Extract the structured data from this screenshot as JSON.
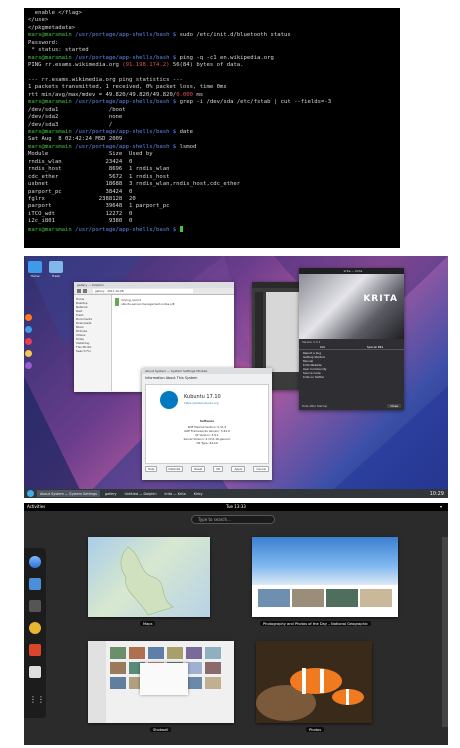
{
  "terminal": {
    "lines": [
      {
        "segments": [
          {
            "t": "  enable </flag>",
            "c": "plain"
          }
        ]
      },
      {
        "segments": [
          {
            "t": "</use>",
            "c": "plain"
          }
        ]
      },
      {
        "segments": [
          {
            "t": "</pkgmetadata>",
            "c": "plain"
          }
        ]
      },
      {
        "segments": [
          {
            "t": "mars@marsmain",
            "c": "user"
          },
          {
            "t": " /usr/portage/app-shells/bash $ ",
            "c": "path"
          },
          {
            "t": "sudo /etc/init.d/bluetooth status",
            "c": "plain"
          }
        ]
      },
      {
        "segments": [
          {
            "t": "Password:",
            "c": "plain"
          }
        ]
      },
      {
        "segments": [
          {
            "t": " * status: started",
            "c": "plain"
          }
        ]
      },
      {
        "segments": [
          {
            "t": "mars@marsmain",
            "c": "user"
          },
          {
            "t": " /usr/portage/app-shells/bash $ ",
            "c": "path"
          },
          {
            "t": "ping -q -c1 en.wikipedia.org",
            "c": "plain"
          }
        ]
      },
      {
        "segments": [
          {
            "t": "PING rr.esams.wikimedia.org ",
            "c": "plain"
          },
          {
            "t": "(91.198.174.2)",
            "c": "red"
          },
          {
            "t": " 56(84) bytes of data.",
            "c": "plain"
          }
        ]
      },
      {
        "segments": [
          {
            "t": "",
            "c": "plain"
          }
        ]
      },
      {
        "segments": [
          {
            "t": "--- rr.esams.wikimedia.org ping statistics ---",
            "c": "plain"
          }
        ]
      },
      {
        "segments": [
          {
            "t": "1 packets transmitted, 1 received, 0% packet loss, time 0ms",
            "c": "plain"
          }
        ]
      },
      {
        "segments": [
          {
            "t": "rtt min/avg/max/mdev = 49.820/49.820/49.820/",
            "c": "plain"
          },
          {
            "t": "0.000",
            "c": "red"
          },
          {
            "t": " ms",
            "c": "plain"
          }
        ]
      },
      {
        "segments": [
          {
            "t": "mars@marsmain",
            "c": "user"
          },
          {
            "t": " /usr/portage/app-shells/bash $ ",
            "c": "path"
          },
          {
            "t": "grep -i /dev/sda /etc/fstab | cut --fields=-3",
            "c": "plain"
          }
        ]
      },
      {
        "segments": [
          {
            "t": "/dev/sda1               /boot",
            "c": "plain"
          }
        ]
      },
      {
        "segments": [
          {
            "t": "/dev/sda2               none",
            "c": "plain"
          }
        ]
      },
      {
        "segments": [
          {
            "t": "/dev/sda3               /",
            "c": "plain"
          }
        ]
      },
      {
        "segments": [
          {
            "t": "mars@marsmain",
            "c": "user"
          },
          {
            "t": " /usr/portage/app-shells/bash $ ",
            "c": "path"
          },
          {
            "t": "date",
            "c": "plain"
          }
        ]
      },
      {
        "segments": [
          {
            "t": "Sat Aug  8 02:42:24 MSD 2009",
            "c": "plain"
          }
        ]
      },
      {
        "segments": [
          {
            "t": "mars@marsmain",
            "c": "user"
          },
          {
            "t": " /usr/portage/app-shells/bash $ ",
            "c": "path"
          },
          {
            "t": "lsmod",
            "c": "plain"
          }
        ]
      },
      {
        "segments": [
          {
            "t": "Module                  Size  Used by",
            "c": "plain"
          }
        ]
      },
      {
        "segments": [
          {
            "t": "rndis_wlan             23424  0",
            "c": "plain"
          }
        ]
      },
      {
        "segments": [
          {
            "t": "rndis_host              8696  1 rndis_wlan",
            "c": "plain"
          }
        ]
      },
      {
        "segments": [
          {
            "t": "cdc_ether               5672  1 rndis_host",
            "c": "plain"
          }
        ]
      },
      {
        "segments": [
          {
            "t": "usbnet                 18688  3 rndis_wlan,rndis_host,cdc_ether",
            "c": "plain"
          }
        ]
      },
      {
        "segments": [
          {
            "t": "parport_pc             38424  0",
            "c": "plain"
          }
        ]
      },
      {
        "segments": [
          {
            "t": "fglrx                2388128  20",
            "c": "plain"
          }
        ]
      },
      {
        "segments": [
          {
            "t": "parport                39648  1 parport_pc",
            "c": "plain"
          }
        ]
      },
      {
        "segments": [
          {
            "t": "iTCO_wdt               12272  0",
            "c": "plain"
          }
        ]
      },
      {
        "segments": [
          {
            "t": "i2c_i801                9380  0",
            "c": "plain"
          }
        ]
      },
      {
        "segments": [
          {
            "t": "mars@marsmain",
            "c": "user"
          },
          {
            "t": " /usr/portage/app-shells/bash $ ",
            "c": "path"
          },
          {
            "t": "",
            "c": "cursor"
          }
        ]
      }
    ]
  },
  "kde": {
    "desktop_icons": [
      "Home",
      "Trash"
    ],
    "dolphin": {
      "title": "gallery — Dolphin",
      "path": "gallery · 2017-10-08",
      "sidebar": [
        "Home",
        "Desktop",
        "Network",
        "Root",
        "Trash",
        "Documents",
        "Downloads",
        "Music",
        "Pictures",
        "Videos",
        "Today",
        "Yesterday",
        "This Month",
        "Search For"
      ],
      "files": [
        "driving_record",
        "ubuntu-server-management-notes.odt"
      ]
    },
    "krita": {
      "title": "krita — Krita",
      "brand": "KRITA",
      "version": "Version 3.3.1",
      "tabs": [
        "Info",
        "Special Bits"
      ],
      "links": [
        "Report a bug",
        "Getting Started",
        "Manual",
        "Krita Website",
        "User Community",
        "Source Code",
        "Krita on Twitter"
      ],
      "footer_check": "Hide After Startup",
      "close_button": "Close"
    },
    "about": {
      "window_title": "About System — System Settings Module",
      "heading": "Information About This System",
      "distro": "Kubuntu 17.10",
      "link": "https://www.kubuntu.org",
      "section": "Software",
      "rows": [
        "KDE Plasma Version: 5.11.5",
        "KDE Frameworks Version: 5.44.0",
        "Qt Version: 5.9.1",
        "Kernel Version: 4.13.0-16-generic",
        "OS Type: 64-bit"
      ],
      "buttons": [
        "Help",
        "Defaults",
        "Reset",
        "OK",
        "Apply",
        "Cancel"
      ]
    },
    "taskbar": {
      "tasks": [
        "About System — System Settings",
        "gallery",
        "Untitled — Dolphin",
        "krita — Krita",
        "Kirby"
      ],
      "clock": "10:29"
    }
  },
  "gnome": {
    "activities": "Activities",
    "clock": "Tue 13:33",
    "search_placeholder": "Type to search…",
    "windows": [
      {
        "label": "Maps"
      },
      {
        "label": "Photography and Photos of the Day – National Geographic"
      },
      {
        "label": "Shotwell"
      },
      {
        "label": "Photos"
      }
    ],
    "dash": [
      "Web browser",
      "Files",
      "Camera",
      "Rhythmbox",
      "Maps",
      "Software",
      "Show Applications"
    ]
  }
}
